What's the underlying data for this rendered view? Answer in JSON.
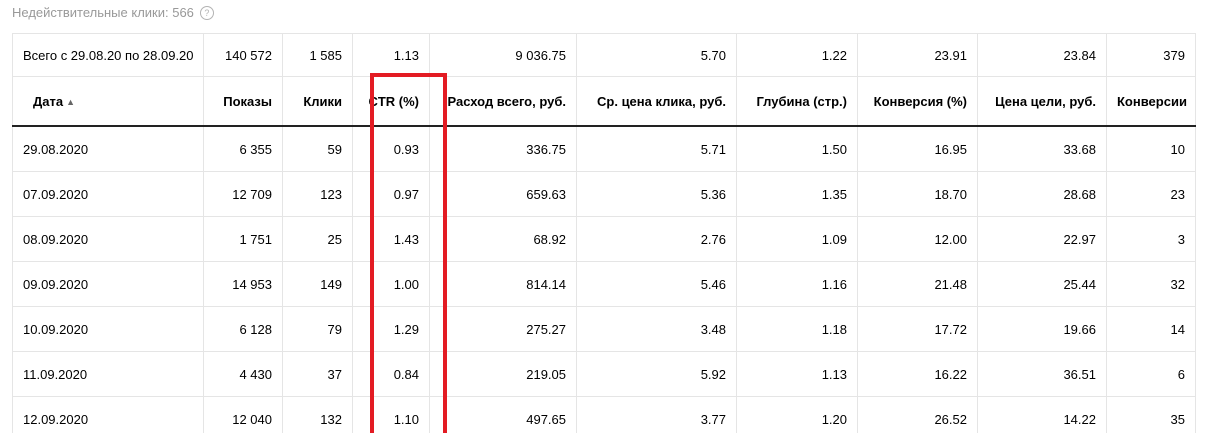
{
  "invalid_clicks": {
    "label": "Недействительные клики: 566",
    "help_icon": "question-circle-icon"
  },
  "table": {
    "totals": {
      "period": "Всего с 29.08.20 по 28.09.20",
      "shows": "140 572",
      "clicks": "1 585",
      "ctr": "1.13",
      "spend": "9 036.75",
      "avg_cpc": "5.70",
      "depth": "1.22",
      "conversion": "23.91",
      "goal_cost": "23.84",
      "conversions": "379"
    },
    "headers": {
      "date": "Дата",
      "shows": "Показы",
      "clicks": "Клики",
      "ctr": "CTR (%)",
      "spend": "Расход всего, руб.",
      "avg_cpc": "Ср. цена клика, руб.",
      "depth": "Глубина (стр.)",
      "conversion": "Конверсия (%)",
      "goal_cost": "Цена цели, руб.",
      "conversions": "Конверсии"
    },
    "sort_indicator": "▲",
    "rows": [
      {
        "date": "29.08.2020",
        "shows": "6 355",
        "clicks": "59",
        "ctr": "0.93",
        "spend": "336.75",
        "avg_cpc": "5.71",
        "depth": "1.50",
        "conversion": "16.95",
        "goal_cost": "33.68",
        "conversions": "10"
      },
      {
        "date": "07.09.2020",
        "shows": "12 709",
        "clicks": "123",
        "ctr": "0.97",
        "spend": "659.63",
        "avg_cpc": "5.36",
        "depth": "1.35",
        "conversion": "18.70",
        "goal_cost": "28.68",
        "conversions": "23"
      },
      {
        "date": "08.09.2020",
        "shows": "1 751",
        "clicks": "25",
        "ctr": "1.43",
        "spend": "68.92",
        "avg_cpc": "2.76",
        "depth": "1.09",
        "conversion": "12.00",
        "goal_cost": "22.97",
        "conversions": "3"
      },
      {
        "date": "09.09.2020",
        "shows": "14 953",
        "clicks": "149",
        "ctr": "1.00",
        "spend": "814.14",
        "avg_cpc": "5.46",
        "depth": "1.16",
        "conversion": "21.48",
        "goal_cost": "25.44",
        "conversions": "32"
      },
      {
        "date": "10.09.2020",
        "shows": "6 128",
        "clicks": "79",
        "ctr": "1.29",
        "spend": "275.27",
        "avg_cpc": "3.48",
        "depth": "1.18",
        "conversion": "17.72",
        "goal_cost": "19.66",
        "conversions": "14"
      },
      {
        "date": "11.09.2020",
        "shows": "4 430",
        "clicks": "37",
        "ctr": "0.84",
        "spend": "219.05",
        "avg_cpc": "5.92",
        "depth": "1.13",
        "conversion": "16.22",
        "goal_cost": "36.51",
        "conversions": "6"
      },
      {
        "date": "12.09.2020",
        "shows": "12 040",
        "clicks": "132",
        "ctr": "1.10",
        "spend": "497.65",
        "avg_cpc": "3.77",
        "depth": "1.20",
        "conversion": "26.52",
        "goal_cost": "14.22",
        "conversions": "35"
      }
    ]
  },
  "highlight": {
    "color": "#e31b23",
    "target_column": "ctr"
  }
}
